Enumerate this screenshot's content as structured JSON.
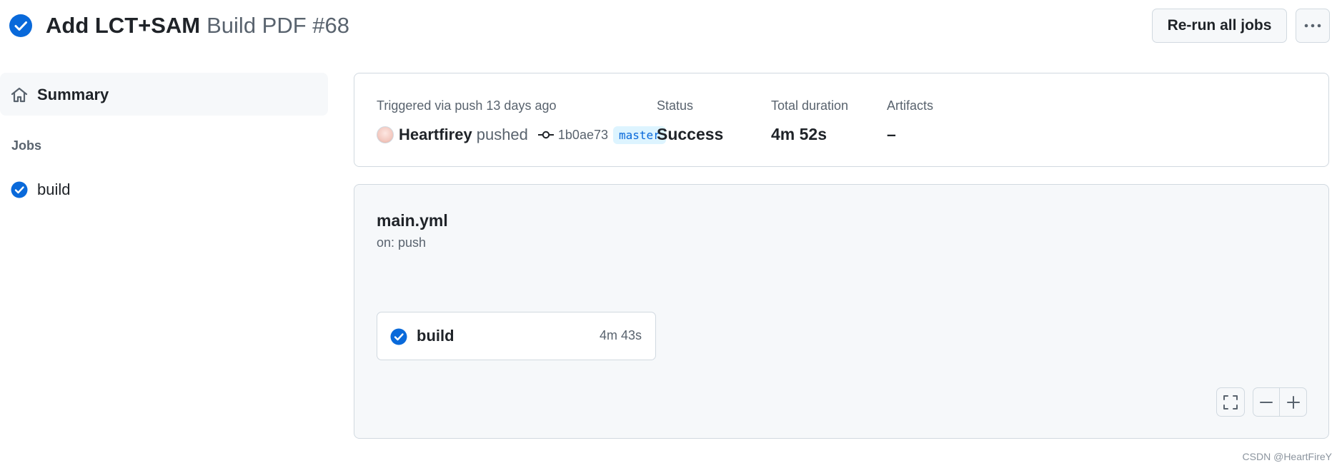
{
  "header": {
    "workflow_title": "Add LCT+SAM",
    "run_label": "Build PDF #68",
    "rerun_label": "Re-run all jobs",
    "status_icon": "check-circle-fill-icon",
    "status_color": "#0969da"
  },
  "sidebar": {
    "summary_label": "Summary",
    "jobs_heading": "Jobs",
    "jobs": [
      {
        "label": "build",
        "status_icon": "check-circle-fill-icon"
      }
    ]
  },
  "summary": {
    "trigger_text": "Triggered via push 13 days ago",
    "actor": "Heartfirey",
    "action": "pushed",
    "commit_sha": "1b0ae73",
    "branch": "master",
    "status_label": "Status",
    "status_value": "Success",
    "duration_label": "Total duration",
    "duration_value": "4m 52s",
    "artifacts_label": "Artifacts",
    "artifacts_value": "–"
  },
  "graph": {
    "workflow_file": "main.yml",
    "trigger": "on: push",
    "jobs": [
      {
        "name": "build",
        "duration": "4m 43s"
      }
    ]
  },
  "watermark": "CSDN @HeartFireY",
  "colors": {
    "accent": "#0969da",
    "border": "#d1d9e0",
    "muted_text": "#59636e",
    "panel_bg": "#f6f8fa",
    "branch_bg": "#ddf4ff"
  }
}
